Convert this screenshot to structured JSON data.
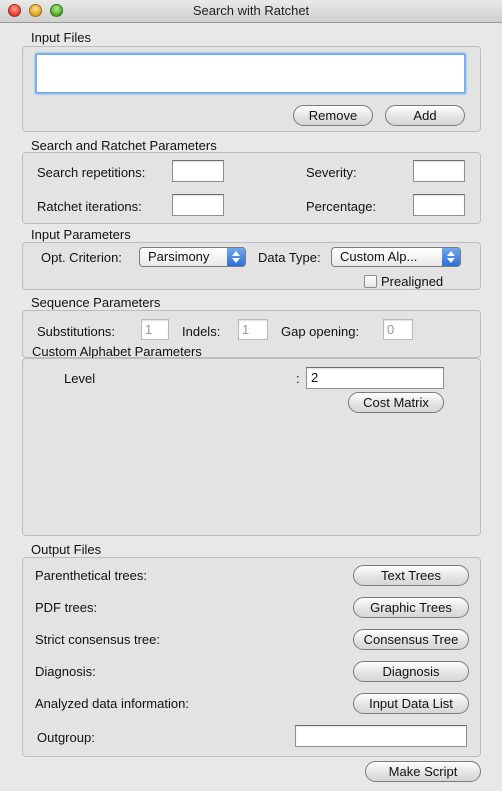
{
  "window": {
    "title": "Search with Ratchet"
  },
  "input_files": {
    "header": "Input Files",
    "remove_label": "Remove",
    "add_label": "Add"
  },
  "search_ratchet": {
    "header": "Search and Ratchet Parameters",
    "search_repetitions_label": "Search repetitions:",
    "search_repetitions_value": "",
    "severity_label": "Severity:",
    "severity_value": "",
    "ratchet_iterations_label": "Ratchet iterations:",
    "ratchet_iterations_value": "",
    "percentage_label": "Percentage:",
    "percentage_value": ""
  },
  "input_params": {
    "header": "Input Parameters",
    "opt_criterion_label": "Opt. Criterion:",
    "opt_criterion_value": "Parsimony",
    "data_type_label": "Data Type:",
    "data_type_value": "Custom Alp...",
    "prealigned_label": "Prealigned",
    "prealigned_checked": false
  },
  "sequence_params": {
    "header": "Sequence Parameters",
    "substitutions_label": "Substitutions:",
    "substitutions_value": "1",
    "indels_label": "Indels:",
    "indels_value": "1",
    "gap_opening_label": "Gap opening:",
    "gap_opening_value": "0"
  },
  "custom_alphabet": {
    "header": "Custom Alphabet Parameters",
    "level_label": "Level",
    "colon": ":",
    "level_value": "2",
    "cost_matrix_label": "Cost Matrix"
  },
  "output_files": {
    "header": "Output Files",
    "rows": [
      {
        "label": "Parenthetical trees:",
        "button": "Text Trees"
      },
      {
        "label": "PDF trees:",
        "button": "Graphic Trees"
      },
      {
        "label": "Strict consensus tree:",
        "button": "Consensus Tree"
      },
      {
        "label": "Diagnosis:",
        "button": "Diagnosis"
      },
      {
        "label": "Analyzed data information:",
        "button": "Input Data List"
      }
    ],
    "outgroup_label": "Outgroup:",
    "outgroup_value": ""
  },
  "footer": {
    "make_script_label": "Make Script"
  },
  "colors": {
    "accent": "#2c6fd6",
    "focus_ring": "#7ab0f0"
  }
}
